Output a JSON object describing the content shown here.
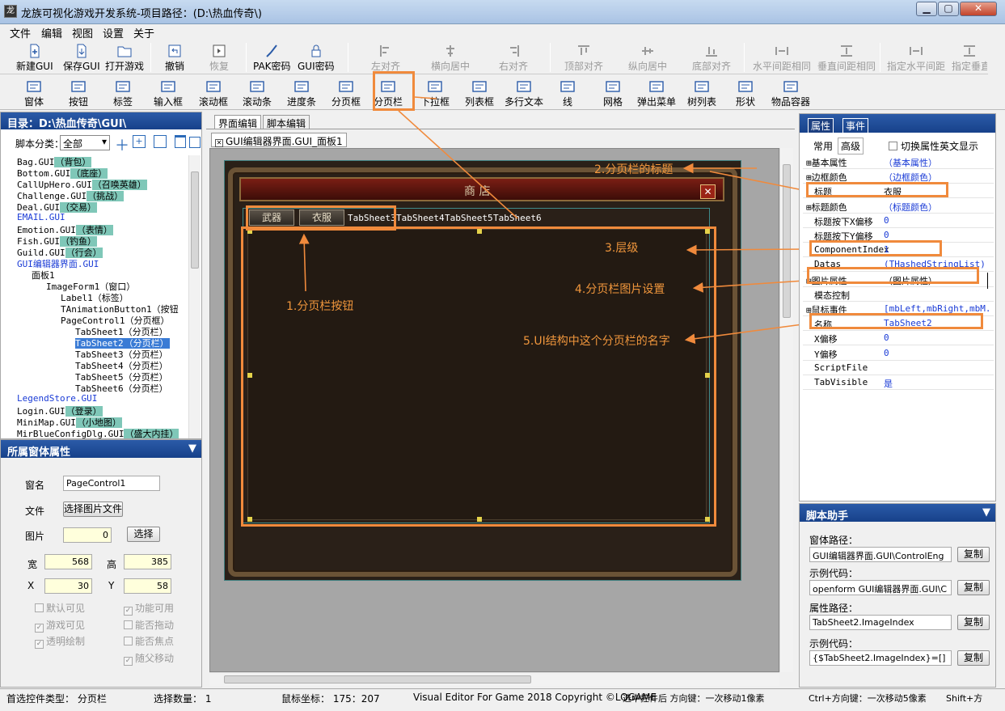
{
  "window": {
    "title": "龙族可视化游戏开发系统-项目路径：(D:\\热血传奇\\)"
  },
  "menu": [
    "文件",
    "编辑",
    "视图",
    "设置",
    "关于"
  ],
  "toolbar1": {
    "new": "新建GUI",
    "save": "保存GUI",
    "open": "打开游戏",
    "undo": "撤销",
    "redo": "恢复",
    "pak": "PAK密码",
    "gui": "GUI密码",
    "align_left": "左对齐",
    "align_hcenter": "横向居中",
    "align_right": "右对齐",
    "align_top": "顶部对齐",
    "align_vcenter": "纵向居中",
    "align_bottom": "底部对齐",
    "hspace": "水平间距相同",
    "vspace": "垂直间距相同",
    "set_hspace": "指定水平间距",
    "set_vspace": "指定垂直"
  },
  "toolbar2": [
    "窗体",
    "按钮",
    "标签",
    "输入框",
    "滚动框",
    "滚动条",
    "进度条",
    "分页框",
    "分页栏",
    "下拉框",
    "列表框",
    "多行文本",
    "线",
    "网格",
    "弹出菜单",
    "树列表",
    "形状",
    "物品容器"
  ],
  "left": {
    "dir_label": "目录：D:\\热血传奇\\GUI\\",
    "category_label": "脚本分类：",
    "category_value": "全部",
    "tree": [
      {
        "name": "Bag.GUI",
        "tag": "（背包）",
        "blue": false,
        "depth": 0
      },
      {
        "name": "Bottom.GUI",
        "tag": "（底座）",
        "blue": false,
        "depth": 0
      },
      {
        "name": "CallUpHero.GUI",
        "tag": "（召唤英雄）",
        "blue": false,
        "depth": 0
      },
      {
        "name": "Challenge.GUI",
        "tag": "（挑战）",
        "blue": false,
        "depth": 0
      },
      {
        "name": "Deal.GUI",
        "tag": "（交易）",
        "blue": false,
        "depth": 0
      },
      {
        "name": "EMAIL.GUI",
        "tag": "",
        "blue": true,
        "depth": 0
      },
      {
        "name": "Emotion.GUI",
        "tag": "（表情）",
        "blue": false,
        "depth": 0
      },
      {
        "name": "Fish.GUI",
        "tag": "（钓鱼）",
        "blue": false,
        "depth": 0
      },
      {
        "name": "Guild.GUI",
        "tag": "（行会）",
        "blue": false,
        "depth": 0
      },
      {
        "name": "GUI编辑器界面.GUI",
        "tag": "",
        "blue": true,
        "depth": 0
      },
      {
        "name": "面板1",
        "tag": "",
        "blue": false,
        "depth": 1
      },
      {
        "name": "ImageForm1（窗口）",
        "tag": "",
        "blue": false,
        "depth": 2
      },
      {
        "name": "Label1（标签）",
        "tag": "",
        "blue": false,
        "depth": 3
      },
      {
        "name": "TAnimationButton1（按钮",
        "tag": "",
        "blue": false,
        "depth": 3
      },
      {
        "name": "PageControl1（分页框）",
        "tag": "",
        "blue": false,
        "depth": 3
      },
      {
        "name": "TabSheet1（分页栏）",
        "tag": "",
        "blue": false,
        "depth": 4
      },
      {
        "name": "TabSheet2",
        "tag": "（分页栏）",
        "blue": false,
        "depth": 4
      },
      {
        "name": "TabSheet3（分页栏）",
        "tag": "",
        "blue": false,
        "depth": 4
      },
      {
        "name": "TabSheet4（分页栏）",
        "tag": "",
        "blue": false,
        "depth": 4
      },
      {
        "name": "TabSheet5（分页栏）",
        "tag": "",
        "blue": false,
        "depth": 4
      },
      {
        "name": "TabSheet6（分页栏）",
        "tag": "",
        "blue": false,
        "depth": 4
      },
      {
        "name": "LegendStore.GUI",
        "tag": "",
        "blue": true,
        "depth": 0
      },
      {
        "name": "Login.GUI",
        "tag": "（登录）",
        "blue": false,
        "depth": 0
      },
      {
        "name": "MiniMap.GUI",
        "tag": "（小地图）",
        "blue": false,
        "depth": 0
      },
      {
        "name": "MirBlueConfigDlg.GUI",
        "tag": "（盛大内挂）",
        "blue": false,
        "depth": 0
      }
    ],
    "props_header": "所属窗体属性",
    "form": {
      "name_label": "窗名",
      "name_value": "PageControl1",
      "file_label": "文件",
      "file_btn": "选择图片文件",
      "img_label": "图片",
      "img_value": "0",
      "img_btn": "选择",
      "w_label": "宽",
      "w_value": "568",
      "h_label": "高",
      "h_value": "385",
      "x_label": "X",
      "x_value": "30",
      "y_label": "Y",
      "y_value": "58",
      "chk": [
        "默认可见",
        "功能可用",
        "游戏可见",
        "能否拖动",
        "透明绘制",
        "能否焦点",
        "随父移动"
      ]
    }
  },
  "center": {
    "tab_ui": "界面编辑",
    "tab_script": "脚本编辑",
    "doc_tab": "GUI编辑器界面.GUI_面板1",
    "shop_title": "商  店",
    "tab_buttons": [
      "武器",
      "衣服"
    ],
    "tab_texts": [
      "TabSheet3",
      "TabSheet4",
      "TabSheet5",
      "TabSheet6"
    ],
    "close_glyph": "✕"
  },
  "annotations": {
    "a1": "1.分页栏按钮",
    "a2": "2.分页栏的标题",
    "a3": "3.层级",
    "a4": "4.分页栏图片设置",
    "a5": "5.UI结构中这个分页栏的名字"
  },
  "right": {
    "tab_props": "属性",
    "tab_events": "事件",
    "sub_common": "常用",
    "sub_adv": "高级",
    "toggle_en": "切换属性英文显示",
    "rows": [
      {
        "k": "⊞基本属性",
        "v": "（基本属性）"
      },
      {
        "k": "⊞边框颜色",
        "v": "（边框颜色）"
      },
      {
        "k": "标题",
        "v": "衣服"
      },
      {
        "k": "⊞标题颜色",
        "v": "（标题颜色）"
      },
      {
        "k": "标题按下X偏移",
        "v": "0"
      },
      {
        "k": "标题按下Y偏移",
        "v": "0"
      },
      {
        "k": "ComponentIndex",
        "v": "1"
      },
      {
        "k": "Datas",
        "v": "(THashedStringList)"
      },
      {
        "k": "⊞图片属性",
        "v": "（图片属性）"
      },
      {
        "k": "模态控制",
        "v": ""
      },
      {
        "k": "⊞鼠标事件",
        "v": "[mbLeft,mbRight,mbM..."
      },
      {
        "k": "名称",
        "v": "TabSheet2"
      },
      {
        "k": "X偏移",
        "v": "0"
      },
      {
        "k": "Y偏移",
        "v": "0"
      },
      {
        "k": "ScriptFile",
        "v": ""
      },
      {
        "k": "TabVisible",
        "v": "是"
      }
    ]
  },
  "script": {
    "header": "脚本助手",
    "l1": "窗体路径：",
    "v1": "GUI编辑器界面.GUI\\ControlEng",
    "l2": "示例代码：",
    "v2": "openform GUI编辑器界面.GUI\\C",
    "l3": "属性路径：",
    "v3": "TabSheet2.ImageIndex",
    "l4": "示例代码：",
    "v4": "{$TabSheet2.ImageIndex}=[]",
    "copy": "复制"
  },
  "status": {
    "type": "首选控件类型： 分页栏",
    "count": "选择数量： 1",
    "mouse": "鼠标坐标： 175：207",
    "ver": "Visual Editor For Game 2018 Copyright ©LOGAME",
    "hint": "选中控件后 方向键：一次移动1像素",
    "ctrl": "Ctrl+方向键：一次移动5像素",
    "shift": "Shift+方"
  },
  "colors": {
    "accent": "#f08a3c",
    "header": "#1d4b97",
    "tag": "#7fc7b8"
  }
}
